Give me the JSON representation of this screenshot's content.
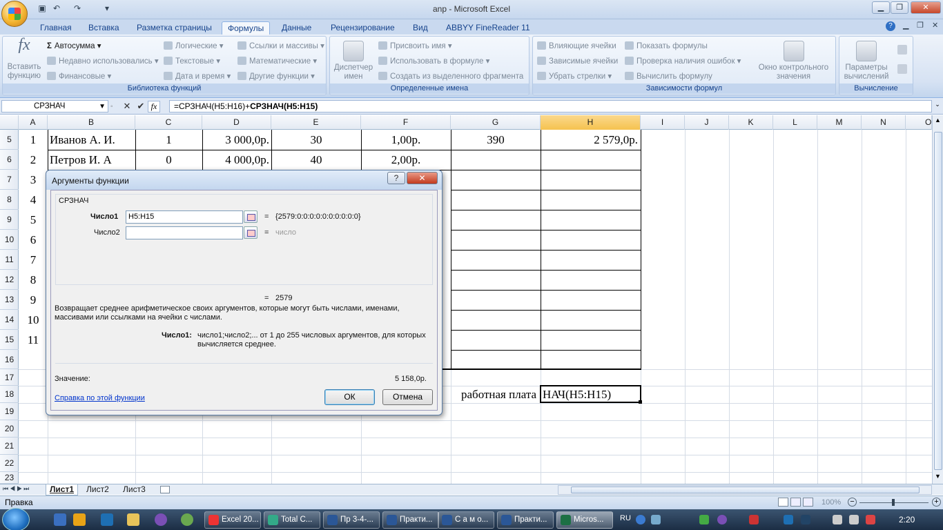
{
  "window": {
    "title": "anp - Microsoft Excel"
  },
  "tabs": [
    "Главная",
    "Вставка",
    "Разметка страницы",
    "Формулы",
    "Данные",
    "Рецензирование",
    "Вид",
    "ABBYY FineReader 11"
  ],
  "active_tab": "Формулы",
  "ribbon": {
    "library": {
      "insert_function": [
        "Вставить",
        "функцию"
      ],
      "autosum": "Автосумма",
      "recent": "Недавно использовались",
      "financial": "Финансовые",
      "logical": "Логические",
      "text": "Текстовые",
      "datetime": "Дата и время",
      "lookup": "Ссылки и массивы",
      "math": "Математические",
      "other": "Другие функции",
      "label": "Библиотека функций"
    },
    "names": {
      "manager": [
        "Диспетчер",
        "имен"
      ],
      "define": "Присвоить имя",
      "use": "Использовать в формуле",
      "create": "Создать из выделенного фрагмента",
      "label": "Определенные имена"
    },
    "audit": {
      "precedents": "Влияющие ячейки",
      "dependents": "Зависимые ячейки",
      "remove": "Убрать стрелки",
      "show": "Показать формулы",
      "errors": "Проверка наличия ошибок",
      "evaluate": "Вычислить формулу",
      "watch": [
        "Окно контрольного",
        "значения"
      ],
      "label": "Зависимости формул"
    },
    "calc": {
      "options": [
        "Параметры",
        "вычислений"
      ],
      "label": "Вычисление"
    }
  },
  "formula_bar": {
    "name_box": "СРЗНАЧ",
    "formula_plain": "=СРЗНАЧ(H5:H16)+",
    "formula_bold": "СРЗНАЧ(H5:H15)"
  },
  "columns": [
    "A",
    "B",
    "C",
    "D",
    "E",
    "F",
    "G",
    "H",
    "I",
    "J",
    "K",
    "L",
    "M",
    "N",
    "O"
  ],
  "rows": [
    "5",
    "6",
    "7",
    "8",
    "9",
    "10",
    "11",
    "12",
    "13",
    "14",
    "15",
    "16",
    "17",
    "18",
    "19",
    "20",
    "21",
    "22",
    "23"
  ],
  "cells": {
    "r5": {
      "a": "1",
      "b": "Иванов А. И.",
      "c": "1",
      "d": "3 000,0р.",
      "e": "30",
      "f": "1,00р.",
      "g": "390",
      "h": "2 579,0р."
    },
    "r6": {
      "a": "2",
      "b": "Петров И. А",
      "c": "0",
      "d": "4 000,0р.",
      "e": "40",
      "f": "2,00р."
    },
    "a_col": [
      "3",
      "4",
      "5",
      "6",
      "7",
      "8",
      "9",
      "10",
      "11"
    ],
    "g18": "работная плата",
    "h18": "НАЧ(H5:H15)"
  },
  "dialog": {
    "title": "Аргументы функции",
    "help_btn": "?",
    "close_btn": "✕",
    "func_name": "СРЗНАЧ",
    "arg1_label": "Число1",
    "arg1_value": "H5:H15",
    "arg1_result": "{2579:0:0:0:0:0:0:0:0:0:0}",
    "arg2_label": "Число2",
    "arg2_value": "",
    "arg2_result": "число",
    "eq": "=",
    "result": "2579",
    "description": "Возвращает среднее арифметическое своих аргументов, которые могут быть числами, именами, массивами или ссылками на ячейки с числами.",
    "arg_help_label": "Число1:",
    "arg_help_text": "число1;число2;... от 1 до 255 числовых аргументов, для которых вычисляется среднее.",
    "value_label": "Значение:",
    "value": "5 158,0р.",
    "help_link": "Справка по этой функции",
    "ok": "ОК",
    "cancel": "Отмена"
  },
  "sheets": [
    "Лист1",
    "Лист2",
    "Лист3"
  ],
  "status": {
    "mode": "Правка",
    "zoom": "100%"
  },
  "taskbar": {
    "buttons": [
      "Excel 20...",
      "Total C...",
      "Пр 3-4-...",
      "Практи...",
      "С а м о...",
      "Практи...",
      "Micros..."
    ],
    "lang": "RU",
    "time": "2:20"
  },
  "colors": {
    "accent": "#15428b",
    "selected_col": "#f5c24f"
  }
}
